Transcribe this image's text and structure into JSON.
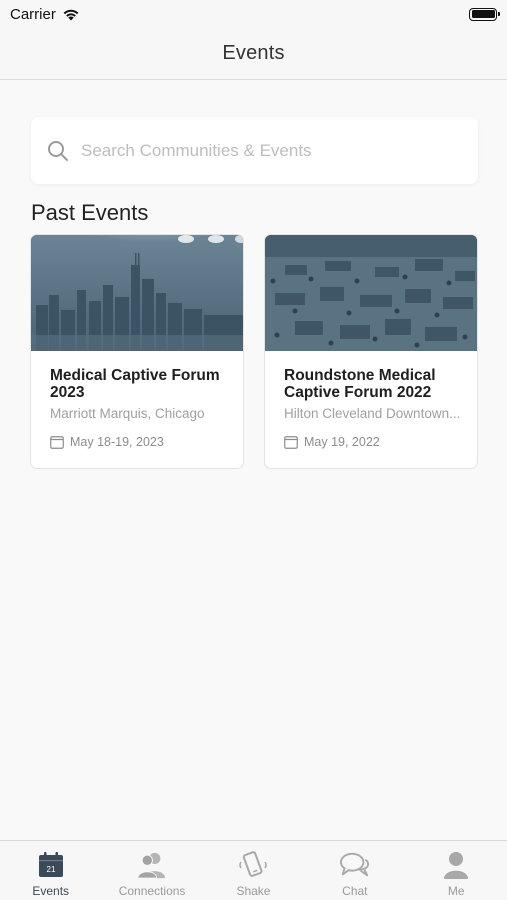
{
  "status_bar": {
    "carrier": "Carrier"
  },
  "nav": {
    "title": "Events"
  },
  "search": {
    "placeholder": "Search Communities & Events"
  },
  "section": {
    "title": "Past Events"
  },
  "events": [
    {
      "title": "Medical Captive Forum 2023",
      "venue": "Marriott Marquis, Chicago",
      "date": "May 18-19, 2023"
    },
    {
      "title": "Roundstone Medical Captive Forum 2022",
      "venue": "Hilton Cleveland Downtown...",
      "date": "May 19, 2022"
    }
  ],
  "tabs": [
    {
      "label": "Events",
      "icon": "calendar-icon",
      "active": true,
      "badge": "21"
    },
    {
      "label": "Connections",
      "icon": "people-icon",
      "active": false
    },
    {
      "label": "Shake",
      "icon": "shake-phone-icon",
      "active": false
    },
    {
      "label": "Chat",
      "icon": "chat-bubbles-icon",
      "active": false
    },
    {
      "label": "Me",
      "icon": "person-icon",
      "active": false
    }
  ],
  "colors": {
    "accent": "#3a4a58",
    "inactive": "#9a9a9a",
    "image_tint": "#4e6778"
  }
}
